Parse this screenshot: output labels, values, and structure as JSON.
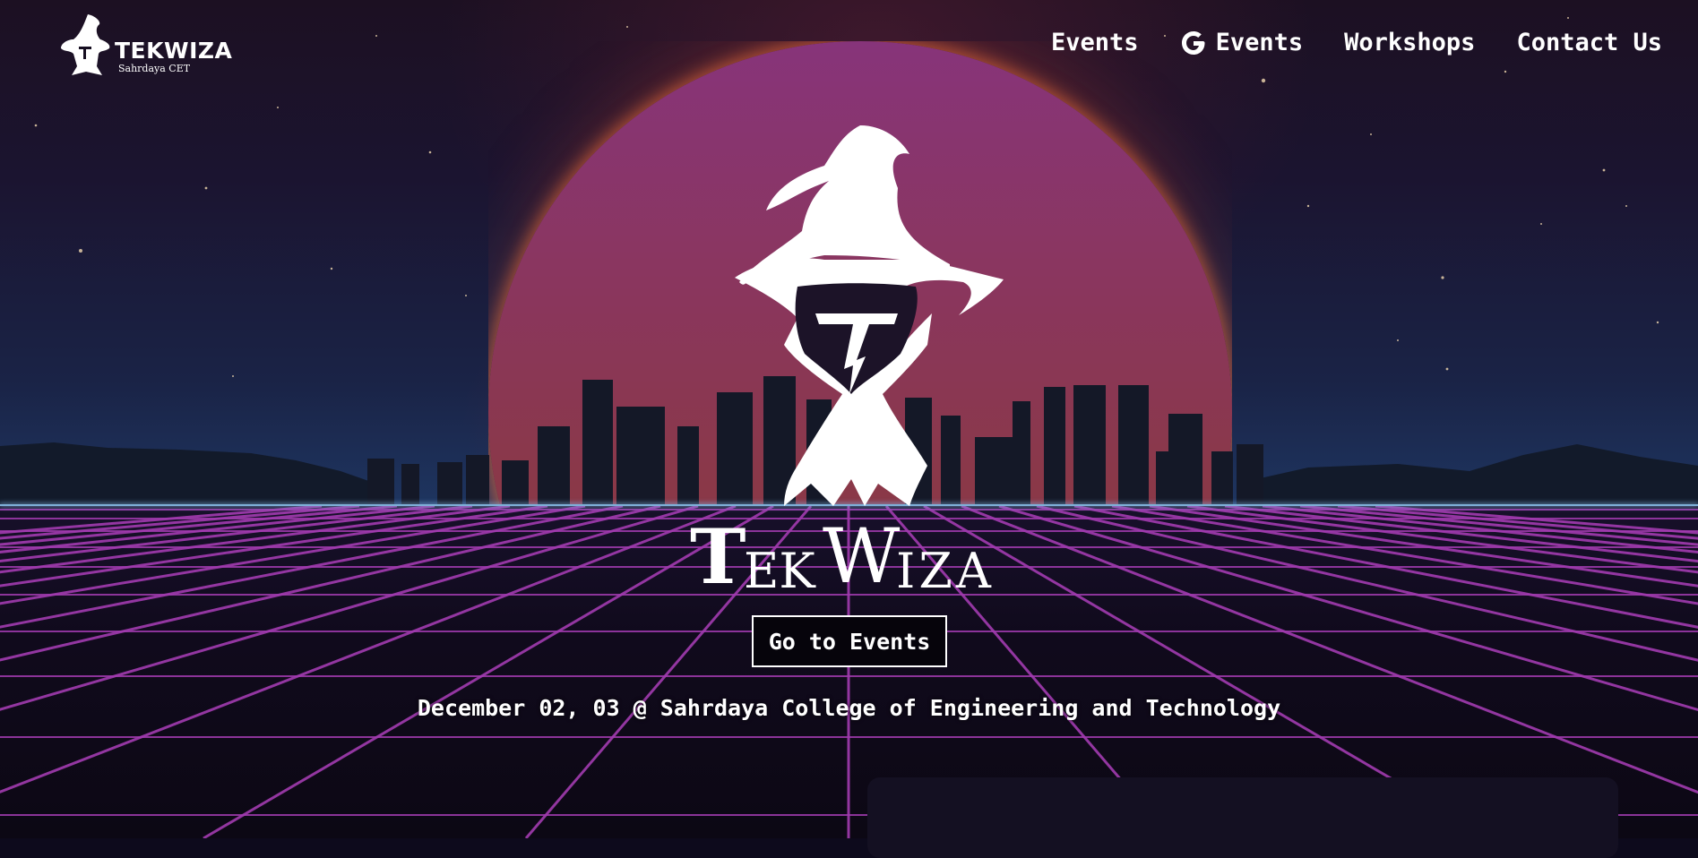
{
  "brand": {
    "name": "TEKWIZA",
    "subtitle": "Sahrdaya CET",
    "hero_letters": [
      "T",
      "EK",
      "W",
      "IZA"
    ]
  },
  "nav": {
    "items": [
      {
        "label": "Events",
        "icon": null
      },
      {
        "label": "Events",
        "icon": "google-g-icon"
      },
      {
        "label": "Workshops",
        "icon": null
      },
      {
        "label": "Contact Us",
        "icon": null
      }
    ]
  },
  "hero": {
    "cta_label": "Go to Events",
    "event_info": "December 02, 03 @ Sahrdaya College of Engineering and Technology"
  },
  "colors": {
    "accent_grid": "#a23bb0",
    "sun_top": "#87347a",
    "sun_bottom": "#7a2c3a",
    "horizon": "#7fb0d8",
    "text": "#ffffff"
  }
}
